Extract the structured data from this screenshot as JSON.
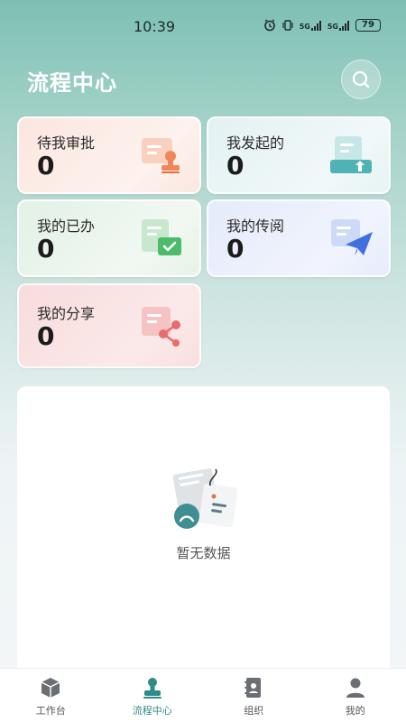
{
  "status_bar": {
    "time": "10:39",
    "network_1": "5G",
    "network_2": "5G",
    "battery": "79"
  },
  "header": {
    "title": "流程中心",
    "search_icon": "search-icon"
  },
  "cards": [
    {
      "label": "待我审批",
      "count": "0",
      "icon": "approval-stamp-icon",
      "color": "#f0875a"
    },
    {
      "label": "我发起的",
      "count": "0",
      "icon": "upload-document-icon",
      "color": "#4fb3b5"
    },
    {
      "label": "我的已办",
      "count": "0",
      "icon": "completed-check-icon",
      "color": "#4dbb6a"
    },
    {
      "label": "我的传阅",
      "count": "0",
      "icon": "paper-plane-icon",
      "color": "#3f6fe0"
    },
    {
      "label": "我的分享",
      "count": "0",
      "icon": "share-icon",
      "color": "#e96b6b"
    }
  ],
  "empty_state": {
    "text": "暂无数据",
    "icon": "empty-document-icon"
  },
  "tab_bar": {
    "tabs": [
      {
        "label": "工作台",
        "icon": "workbench-cube-icon",
        "active": false
      },
      {
        "label": "流程中心",
        "icon": "process-stamp-icon",
        "active": true
      },
      {
        "label": "组织",
        "icon": "contacts-book-icon",
        "active": false
      },
      {
        "label": "我的",
        "icon": "user-icon",
        "active": false
      }
    ],
    "active_color": "#2e8b86",
    "inactive_color": "#555555"
  }
}
